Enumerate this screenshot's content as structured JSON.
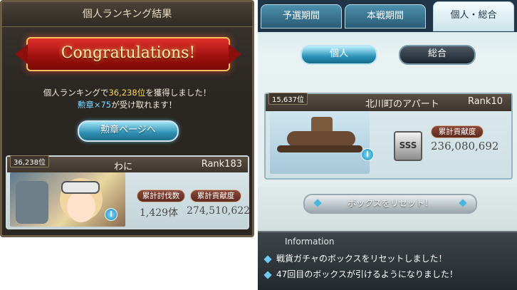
{
  "left": {
    "title": "個人ランキング結果",
    "banner": "Congratulations!",
    "rank_msg_pre": "個人ランキングで",
    "rank_msg_rank": "36,238位",
    "rank_msg_post": "を獲得しました！",
    "medal_msg_hl": "勲章×75",
    "medal_msg_post": "が受け取れます！",
    "medal_button": "勲章ページへ",
    "card": {
      "position": "36,238位",
      "name": "わに",
      "rank": "Rank183",
      "label_kills": "累計討伐数",
      "label_contrib": "累計貢献度",
      "kills": "1,429体",
      "contrib": "274,510,622",
      "info_icon": "i"
    }
  },
  "right": {
    "tabs": [
      "予選期間",
      "本戦期間",
      "個人・総合"
    ],
    "active_tab": "個人・総合",
    "toggle_individual": "個人",
    "toggle_total": "総合",
    "card": {
      "position": "15,637位",
      "name": "北川町のアパート",
      "rank": "Rank10",
      "badge": "SSS",
      "label_contrib": "累計貢献度",
      "contrib": "236,080,692",
      "info_icon": "i"
    },
    "reset_button": "ボックスをリセット！",
    "info": {
      "title": "Information",
      "lines": [
        "戦貨ガチャのボックスをリセットしました！",
        "47回目のボックスが引けるようになりました！"
      ]
    }
  },
  "colors": {
    "accent_gold": "#ffd84a",
    "accent_cyan": "#7fd8ff",
    "ribbon_red": "#c81e1a"
  }
}
